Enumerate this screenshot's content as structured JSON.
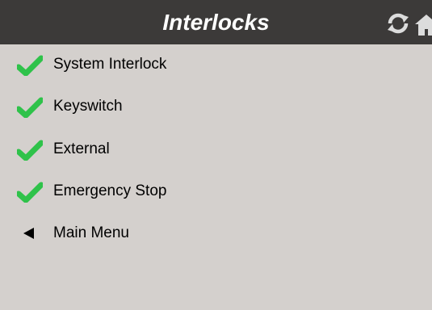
{
  "header": {
    "title": "Interlocks",
    "icons": [
      "refresh-icon",
      "home-icon"
    ]
  },
  "menu": {
    "items": [
      {
        "label": "System Interlock",
        "icon": "check-icon",
        "status": "ok"
      },
      {
        "label": "Keyswitch",
        "icon": "check-icon",
        "status": "ok"
      },
      {
        "label": "External",
        "icon": "check-icon",
        "status": "ok"
      },
      {
        "label": "Emergency Stop",
        "icon": "check-icon",
        "status": "ok"
      },
      {
        "label": "Main Menu",
        "icon": "back-arrow-icon"
      }
    ]
  },
  "colors": {
    "header_bg": "#3c3a39",
    "body_bg": "#d4d0cd",
    "check": "#2fc24a",
    "header_text": "#ffffff"
  }
}
